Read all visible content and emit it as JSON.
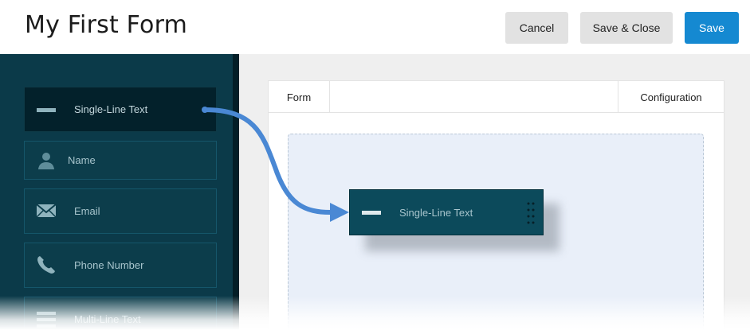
{
  "header": {
    "title": "My First Form",
    "cancel_label": "Cancel",
    "save_close_label": "Save & Close",
    "save_label": "Save"
  },
  "sidebar": {
    "items": [
      {
        "label": "Single-Line Text",
        "icon": "dash-icon",
        "active": true
      },
      {
        "label": "Name",
        "icon": "person-icon",
        "active": false
      },
      {
        "label": "Email",
        "icon": "envelope-icon",
        "active": false
      },
      {
        "label": "Phone Number",
        "icon": "phone-icon",
        "active": false
      },
      {
        "label": "Multi-Line Text",
        "icon": "lines-icon",
        "active": false
      }
    ]
  },
  "tabs": {
    "form": "Form",
    "configuration": "Configuration"
  },
  "dragged_field": {
    "label": "Single-Line Text",
    "icon": "dash-icon"
  },
  "colors": {
    "sidebar_bg": "#0b3a49",
    "save_button": "#1589d1",
    "arrow": "#4a88d4",
    "dropzone_bg": "#e9eff9"
  }
}
